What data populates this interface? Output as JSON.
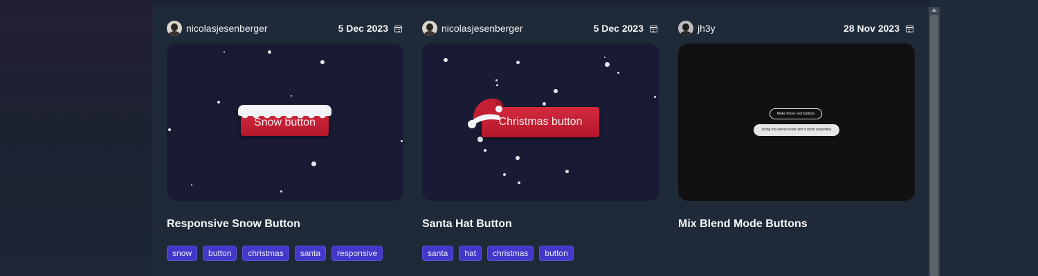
{
  "cards": [
    {
      "author": "nicolasjesenberger",
      "date": "5 Dec 2023",
      "avatar_icon": "user-avatar",
      "preview_button": "Snow button",
      "title": "Responsive Snow Button",
      "tags": [
        "snow",
        "button",
        "christmas",
        "santa",
        "responsive"
      ]
    },
    {
      "author": "nicolasjesenberger",
      "date": "5 Dec 2023",
      "avatar_icon": "user-avatar",
      "preview_button": "Christmas button",
      "title": "Santa Hat Button",
      "tags": [
        "santa",
        "hat",
        "christmas",
        "button"
      ]
    },
    {
      "author": "jh3y",
      "date": "28 Nov 2023",
      "avatar_icon": "user-avatar",
      "preview_pill_1": "Make these cool buttons",
      "preview_pill_2": "Using mix-blend-mode and custom properties",
      "title": "Mix Blend Mode Buttons",
      "tags": []
    }
  ],
  "colors": {
    "page_bg": "#1f2a38",
    "tag_bg": "#4338ca",
    "button_red": "#c41f34",
    "preview_night": "#191a33"
  }
}
